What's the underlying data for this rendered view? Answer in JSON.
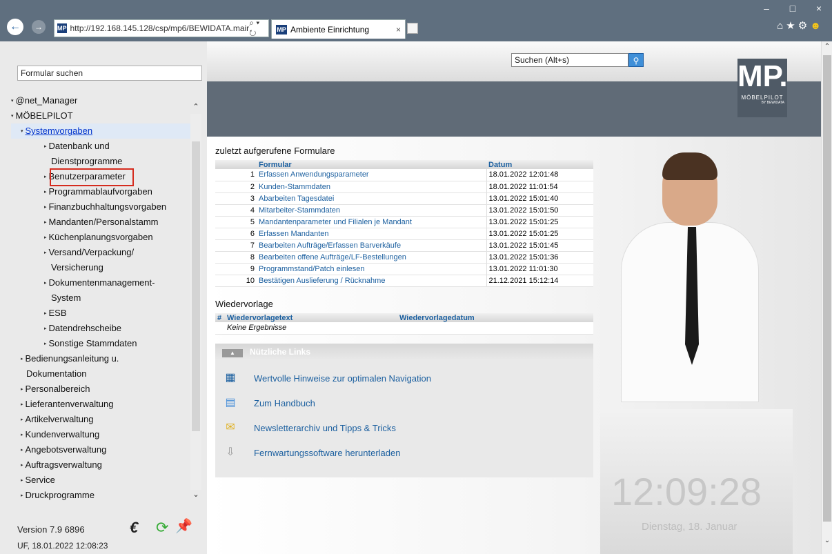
{
  "browser": {
    "url": "http://192.168.145.128/csp/mp6/BEWIDATA.mair",
    "tab_title": "Ambiente Einrichtung",
    "favicon_text": "MP"
  },
  "header": {
    "search_placeholder": "Suchen (Alt+s)",
    "logo_text": "MP.",
    "logo_sub": "MÖBELPILOT",
    "logo_sub2": "BY BEWIDATA"
  },
  "sidebar": {
    "form_search": "Formular suchen",
    "items": [
      {
        "label": "@net_Manager",
        "level": 0
      },
      {
        "label": "MÖBELPILOT",
        "level": 0
      },
      {
        "label": "Systemvorgaben",
        "level": 1
      },
      {
        "label": "Datenbank und",
        "level": 2
      },
      {
        "label": "Dienstprogramme",
        "level": 3
      },
      {
        "label": "Benutzerparameter",
        "level": 2
      },
      {
        "label": "Programmablaufvorgaben",
        "level": 2
      },
      {
        "label": "Finanzbuchhaltungsvorgaben",
        "level": 2
      },
      {
        "label": "Mandanten/Personalstamm",
        "level": 2
      },
      {
        "label": "Küchenplanungsvorgaben",
        "level": 2
      },
      {
        "label": "Versand/Verpackung/",
        "level": 2
      },
      {
        "label": "Versicherung",
        "level": 3
      },
      {
        "label": "Dokumentenmanagement-",
        "level": 2
      },
      {
        "label": "System",
        "level": 3
      },
      {
        "label": "ESB",
        "level": 2
      },
      {
        "label": "Datendrehscheibe",
        "level": 2
      },
      {
        "label": "Sonstige Stammdaten",
        "level": 2
      },
      {
        "label": "Bedienungsanleitung u.",
        "level": 1
      },
      {
        "label": "Dokumentation",
        "level": 4
      },
      {
        "label": "Personalbereich",
        "level": 1
      },
      {
        "label": "Lieferantenverwaltung",
        "level": 1
      },
      {
        "label": "Artikelverwaltung",
        "level": 1
      },
      {
        "label": "Kundenverwaltung",
        "level": 1
      },
      {
        "label": "Angebotsverwaltung",
        "level": 1
      },
      {
        "label": "Auftragsverwaltung",
        "level": 1
      },
      {
        "label": "Service",
        "level": 1
      },
      {
        "label": "Druckprogramme",
        "level": 1
      }
    ],
    "version": "Version 7.9 6896",
    "user_info": "UF, 18.01.2022 12:08:23"
  },
  "recent": {
    "title": "zuletzt aufgerufene Formulare",
    "col_formular": "Formular",
    "col_datum": "Datum",
    "rows": [
      {
        "n": "1",
        "formular": "Erfassen Anwendungsparameter",
        "datum": "18.01.2022 12:01:48"
      },
      {
        "n": "2",
        "formular": "Kunden-Stammdaten",
        "datum": "18.01.2022 11:01:54"
      },
      {
        "n": "3",
        "formular": "Abarbeiten Tagesdatei",
        "datum": "13.01.2022 15:01:40"
      },
      {
        "n": "4",
        "formular": "Mitarbeiter-Stammdaten",
        "datum": "13.01.2022 15:01:50"
      },
      {
        "n": "5",
        "formular": "Mandantenparameter und Filialen je Mandant",
        "datum": "13.01.2022 15:01:25"
      },
      {
        "n": "6",
        "formular": "Erfassen Mandanten",
        "datum": "13.01.2022 15:01:25"
      },
      {
        "n": "7",
        "formular": "Bearbeiten Aufträge/Erfassen Barverkäufe",
        "datum": "13.01.2022 15:01:45"
      },
      {
        "n": "8",
        "formular": "Bearbeiten offene Aufträge/LF-Bestellungen",
        "datum": "13.01.2022 15:01:36"
      },
      {
        "n": "9",
        "formular": "Programmstand/Patch einlesen",
        "datum": "13.01.2022 11:01:30"
      },
      {
        "n": "10",
        "formular": "Bestätigen Auslieferung / Rücknahme",
        "datum": "21.12.2021 15:12:14"
      }
    ]
  },
  "wiedervorlage": {
    "title": "Wiedervorlage",
    "col_hash": "#",
    "col_text": "Wiedervorlagetext",
    "col_datum": "Wiedervorlagedatum",
    "empty": "Keine Ergebnisse"
  },
  "links": {
    "title": "Nützliche Links",
    "items": [
      "Wertvolle Hinweise zur optimalen Navigation",
      "Zum Handbuch",
      "Newsletterarchiv und Tipps & Tricks",
      "Fernwartungssoftware herunterladen"
    ]
  },
  "clock": {
    "time": "12:09:28",
    "date": "Dienstag, 18. Januar"
  }
}
